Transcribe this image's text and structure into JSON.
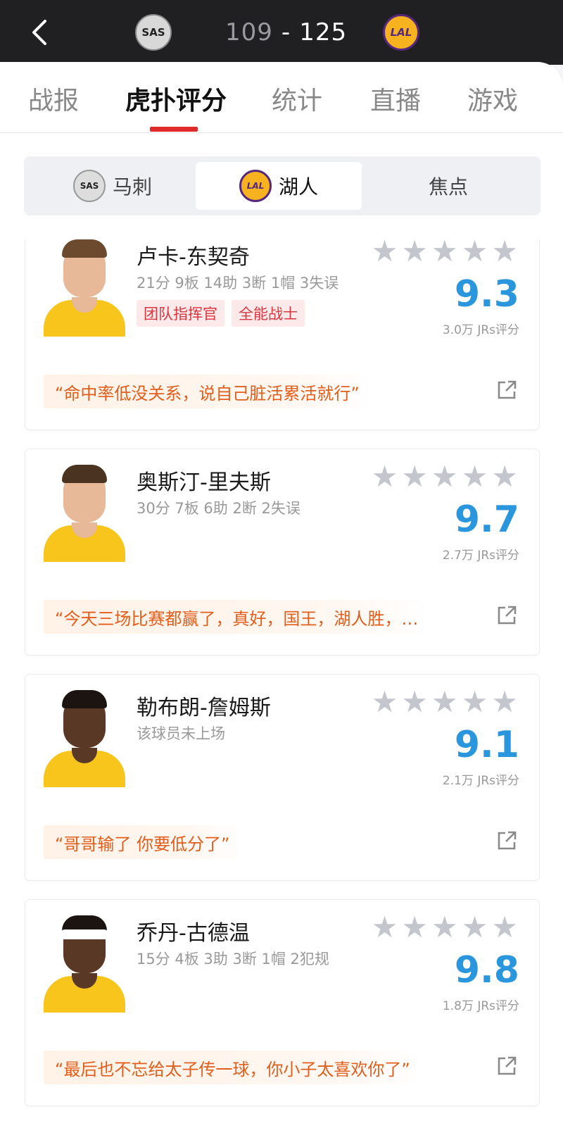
{
  "header": {
    "back_icon": "chevron-left-icon",
    "away_team_logo": "SAS",
    "home_team_logo": "LAL",
    "away_score": "109",
    "separator": "-",
    "home_score": "125"
  },
  "tabs": [
    {
      "label": "战报"
    },
    {
      "label": "虎扑评分"
    },
    {
      "label": "统计"
    },
    {
      "label": "直播"
    },
    {
      "label": "游戏"
    }
  ],
  "active_tab": "虎扑评分",
  "segment": {
    "items": [
      {
        "label": "马刺",
        "logo": "SAS"
      },
      {
        "label": "湖人",
        "logo": "LAL"
      },
      {
        "label": "焦点"
      }
    ],
    "active": "湖人"
  },
  "colors": {
    "header_bg": "#202023",
    "tab_accent": "#e02a2a",
    "rating_blue": "#2a96dd",
    "quote_orange": "#e25e1c",
    "tag_red": "#d9363e",
    "star_grey": "#c3c6cd"
  },
  "players": [
    {
      "name": "卢卡-东契奇",
      "stats": "21分 9板 14助 3断 1帽 3失误",
      "tags": [
        "团队指挥官",
        "全能战士"
      ],
      "rating": "9.3",
      "votes": "3.0万 JRs评分",
      "quote": "“命中率低没关系，说自己脏活累活就行”"
    },
    {
      "name": "奥斯汀-里夫斯",
      "stats": "30分 7板 6助 2断 2失误",
      "tags": [],
      "rating": "9.7",
      "votes": "2.7万 JRs评分",
      "quote": "“今天三场比赛都赢了，真好，国王，湖人胜，…"
    },
    {
      "name": "勒布朗-詹姆斯",
      "stats": "该球员未上场",
      "tags": [],
      "rating": "9.1",
      "votes": "2.1万 JRs评分",
      "quote": "“哥哥输了 你要低分了”"
    },
    {
      "name": "乔丹-古德温",
      "stats": "15分 4板 3助 3断 1帽 2犯规",
      "tags": [],
      "rating": "9.8",
      "votes": "1.8万 JRs评分",
      "quote": "“最后也不忘给太子传一球，你小子太喜欢你了”"
    }
  ]
}
